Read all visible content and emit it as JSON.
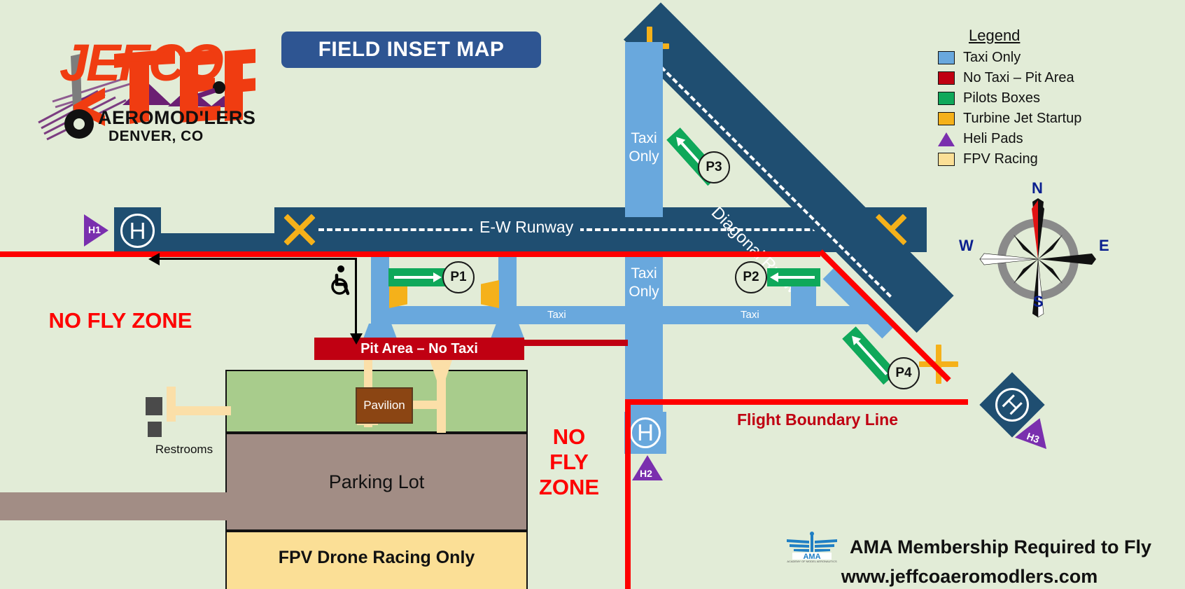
{
  "title": "FIELD INSET MAP",
  "logo": {
    "brand": "JEFCO",
    "line2": "AEROMOD'LERS",
    "line3": "DENVER, CO"
  },
  "legend": {
    "heading": "Legend",
    "items": [
      {
        "label": "Taxi Only",
        "color": "#69a8dd",
        "shape": "square"
      },
      {
        "label": "No Taxi – Pit Area",
        "color": "#c00012",
        "shape": "square"
      },
      {
        "label": "Pilots Boxes",
        "color": "#0fa85a",
        "shape": "square"
      },
      {
        "label": "Turbine Jet Startup",
        "color": "#f5b11a",
        "shape": "square"
      },
      {
        "label": "Heli Pads",
        "color": "#7a2fae",
        "shape": "triangle"
      },
      {
        "label": "FPV Racing",
        "color": "#fbdf96",
        "shape": "square"
      }
    ]
  },
  "runways": {
    "ew": {
      "label": "E-W Runway",
      "color": "#1f4e71"
    },
    "diagonal": {
      "label": "Diagonal Runway",
      "color": "#1f4e71"
    }
  },
  "taxiways": {
    "taxi_only_north": "Taxi\nOnly",
    "taxi_only_north_line1": "Taxi",
    "taxi_only_north_line2": "Only",
    "taxi_only_south_line1": "Taxi",
    "taxi_only_south_line2": "Only",
    "taxi_label_west": "Taxi",
    "taxi_label_east": "Taxi",
    "color": "#69a8dd"
  },
  "pilot_boxes": [
    {
      "id": "P1",
      "direction": "right"
    },
    {
      "id": "P2",
      "direction": "left"
    },
    {
      "id": "P3",
      "direction": "down-left"
    },
    {
      "id": "P4",
      "direction": "up-right"
    }
  ],
  "heli_pads": [
    {
      "id": "H1",
      "marker": "H"
    },
    {
      "id": "H2",
      "marker": "H"
    },
    {
      "id": "H3",
      "marker": "H"
    }
  ],
  "zones": {
    "pit_banner": "Pit Area – No Taxi",
    "no_fly_west_line1": "NO FLY ZONE",
    "no_fly_center_line1": "NO",
    "no_fly_center_line2": "FLY",
    "no_fly_center_line3": "ZONE",
    "flight_boundary": "Flight Boundary Line",
    "parking_lot": "Parking Lot",
    "fpv": "FPV Drone Racing Only",
    "pavilion": "Pavilion",
    "restrooms": "Restrooms"
  },
  "compass": {
    "north": "N",
    "south": "S",
    "east": "E",
    "west": "W"
  },
  "footer": {
    "ama_logo_text": "AMA",
    "line1": "AMA Membership Required to Fly",
    "line2": "www.jeffcoaeromodlers.com"
  },
  "colors": {
    "background": "#e2ecd7",
    "runway": "#1f4e71",
    "taxi": "#69a8dd",
    "pilot_box": "#0fa85a",
    "turbine": "#f5b11a",
    "heli": "#7a2fae",
    "no_fly_red": "#fe0000",
    "pit_red": "#c00012",
    "banner_blue": "#2e5592",
    "grass": "#a8cc8c",
    "parking": "#a28d85",
    "fpv": "#fbdf96",
    "pavilion": "#8b4513",
    "path": "#fbdfa8"
  }
}
